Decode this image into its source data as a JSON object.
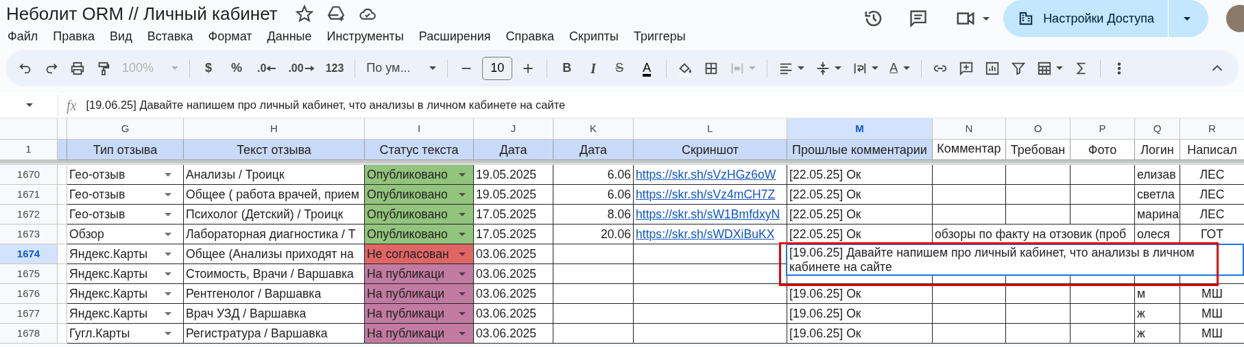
{
  "document": {
    "title": "Неболит ORM // Личный кабинет"
  },
  "share_button": {
    "label": "Настройки Доступа"
  },
  "menu": [
    "Файл",
    "Правка",
    "Вид",
    "Вставка",
    "Формат",
    "Данные",
    "Инструменты",
    "Расширения",
    "Справка",
    "Скрипты",
    "Триггеры"
  ],
  "toolbar": {
    "zoom": {
      "label": "100%",
      "disabled": true
    },
    "currency": "$",
    "percent": "%",
    "decrease_decimals": ".0",
    "increase_decimals": ".00",
    "number_format": "123",
    "font": "По ум...",
    "font_size": "10",
    "bold": "B",
    "italic": "I",
    "strikethrough": "S",
    "text_color": "A",
    "text_rotation": "A",
    "merge": {
      "disabled": true
    }
  },
  "formula_bar": {
    "label": "fx",
    "value": "[19.06.25] Давайте напишем про личный кабинет, что анализы в личном кабинете на сайте"
  },
  "header_row": {
    "number": "1"
  },
  "columns": [
    {
      "letter": "G",
      "header": "Тип отзыва",
      "selected": false,
      "color": "#c9daf8"
    },
    {
      "letter": "H",
      "header": "Текст отзыва",
      "selected": false,
      "color": "#c9daf8"
    },
    {
      "letter": "I",
      "header": "Статус текста",
      "selected": false,
      "color": "#c9daf8"
    },
    {
      "letter": "J",
      "header": "Дата",
      "selected": false,
      "color": "#c9daf8"
    },
    {
      "letter": "K",
      "header": "Дата",
      "selected": false,
      "color": "#c9daf8"
    },
    {
      "letter": "L",
      "header": "Скриншот",
      "selected": false,
      "color": "#c9daf8"
    },
    {
      "letter": "M",
      "header": "Прошлые комментарии",
      "selected": true,
      "color": "#c9daf8"
    },
    {
      "letter": "N",
      "header": "Комментар",
      "selected": false,
      "color": "#ffffff"
    },
    {
      "letter": "O",
      "header": "Требован",
      "selected": false,
      "color": "#ffffff"
    },
    {
      "letter": "P",
      "header": "Фото",
      "selected": false,
      "color": "#ffffff"
    },
    {
      "letter": "Q",
      "header": "Логин",
      "selected": false,
      "color": "#ffffff"
    },
    {
      "letter": "R",
      "header": "Написал",
      "selected": false,
      "color": "#ffffff"
    }
  ],
  "rows": [
    {
      "number": "1670",
      "selected": false,
      "type": "Гео-отзыв",
      "review_text": "Анализы / Троицк",
      "status": {
        "label": "Опубликовано",
        "color": "#93c47d"
      },
      "date": "19.05.2025",
      "date_2": "6.06",
      "screenshot": "https://skr.sh/sVzHGz6oW",
      "past_comments": "[22.05.25] Ок",
      "login": "елизав",
      "author": "ЛЕС"
    },
    {
      "number": "1671",
      "selected": false,
      "type": "Гео-отзыв",
      "review_text": "Общее ( работа врачей, прием",
      "status": {
        "label": "Опубликовано",
        "color": "#93c47d"
      },
      "date": "19.05.2025",
      "date_2": "6.06",
      "screenshot": "https://skr.sh/sVz4mCH7Z",
      "past_comments": "[22.05.25] Ок",
      "login": "светла",
      "author": "ЛЕС"
    },
    {
      "number": "1672",
      "selected": false,
      "type": "Гео-отзыв",
      "review_text": "Психолог (Детский) / Троицк",
      "status": {
        "label": "Опубликовано",
        "color": "#93c47d"
      },
      "date": "17.05.2025",
      "date_2": "8.06",
      "screenshot": "https://skr.sh/sW1BmfdxyN",
      "past_comments": "[22.05.25] Ок",
      "login": "марина",
      "author": "ЛЕС"
    },
    {
      "number": "1673",
      "selected": false,
      "type": "Обзор",
      "review_text": "Лабораторная диагностика / Т",
      "status": {
        "label": "Опубликовано",
        "color": "#93c47d"
      },
      "date": "17.05.2025",
      "date_2": "20.06",
      "screenshot": "https://skr.sh/sWDXiBuKX",
      "past_comments": "[22.05.25] Ок",
      "comment_ptm": "обзоры по факту на отзовик (проб",
      "login": "олеся",
      "author": "ГОТ"
    },
    {
      "number": "1674",
      "selected": true,
      "type": "Яндекс.Карты",
      "review_text": "Общее (Анализы приходят на",
      "status": {
        "label": "Не согласован",
        "color": "#e06666"
      },
      "date": "03.06.2025"
    },
    {
      "number": "1675",
      "selected": false,
      "type": "Яндекс.Карты",
      "review_text": "Стоимость, Врачи / Варшавка",
      "status": {
        "label": "На публикаци",
        "color": "#c27ba0"
      },
      "date": "03.06.2025"
    },
    {
      "number": "1676",
      "selected": false,
      "type": "Яндекс.Карты",
      "review_text": "Рентгенолог / Варшавка",
      "status": {
        "label": "На публикаци",
        "color": "#c27ba0"
      },
      "date": "03.06.2025",
      "past_comments": "[19.06.25] Ок",
      "login": "м",
      "author": "МШ"
    },
    {
      "number": "1677",
      "selected": false,
      "type": "Яндекс.Карты",
      "review_text": "Врач УЗД / Варшавка",
      "status": {
        "label": "На публикаци",
        "color": "#c27ba0"
      },
      "date": "03.06.2025",
      "past_comments": "[19.06.25] Ок",
      "login": "ж",
      "author": "МШ"
    },
    {
      "number": "1678",
      "selected": false,
      "type": "Гугл.Карты",
      "review_text": "Регистратура / Варшавка",
      "status": {
        "label": "На публикаци",
        "color": "#c27ba0"
      },
      "date": "03.06.2025",
      "past_comments": "[19.06.25] Ок",
      "login": "ж",
      "author": "МШ"
    }
  ],
  "cell_editor": {
    "value": "[19.06.25] Давайте напишем про личный кабинет, что анализы в личном кабинете на сайте"
  }
}
